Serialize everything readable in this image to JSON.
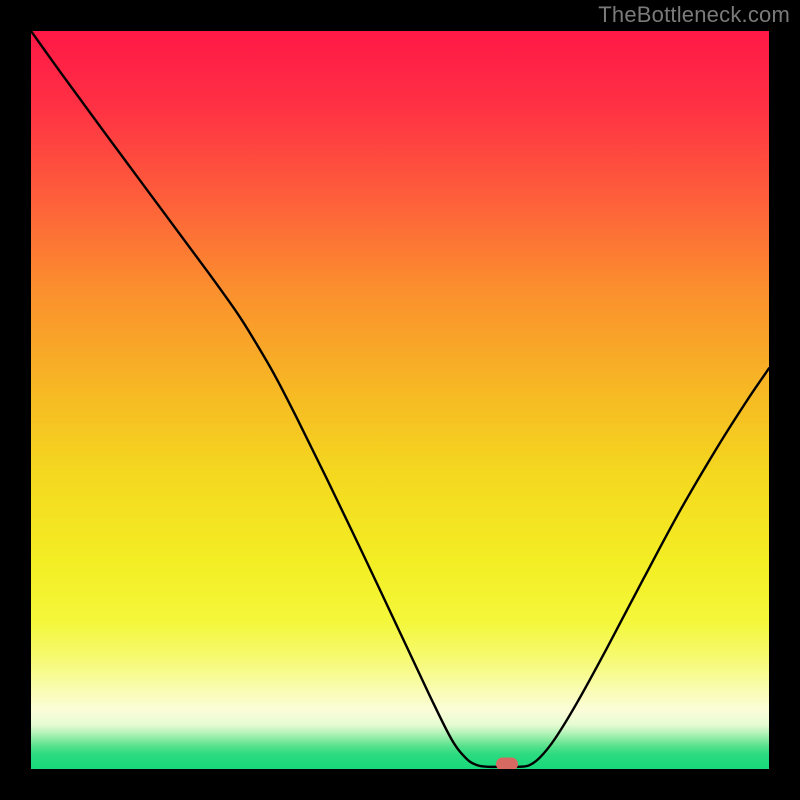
{
  "watermark": "TheBottleneck.com",
  "colors": {
    "frame_bg": "#000000",
    "curve_stroke": "#000000",
    "marker_fill": "#d66a63",
    "watermark_text": "#7a7a7a"
  },
  "gradient_stops": [
    {
      "pct": 0,
      "color": "#ff1846"
    },
    {
      "pct": 10,
      "color": "#ff3044"
    },
    {
      "pct": 22,
      "color": "#fe5c3b"
    },
    {
      "pct": 35,
      "color": "#fb8f2e"
    },
    {
      "pct": 48,
      "color": "#f7b624"
    },
    {
      "pct": 60,
      "color": "#f4d81f"
    },
    {
      "pct": 72,
      "color": "#f3ee24"
    },
    {
      "pct": 80,
      "color": "#f4f73a"
    },
    {
      "pct": 85,
      "color": "#f6fa71"
    },
    {
      "pct": 89,
      "color": "#f9fcae"
    },
    {
      "pct": 92,
      "color": "#fbfdd8"
    },
    {
      "pct": 94,
      "color": "#e6fbd2"
    },
    {
      "pct": 95,
      "color": "#baf4bc"
    },
    {
      "pct": 96,
      "color": "#86eaa0"
    },
    {
      "pct": 97,
      "color": "#52e18b"
    },
    {
      "pct": 98,
      "color": "#2cdb80"
    },
    {
      "pct": 100,
      "color": "#17d87b"
    }
  ],
  "chart_data": {
    "type": "line",
    "title": "",
    "xlabel": "",
    "ylabel": "",
    "xlim": [
      0,
      100
    ],
    "ylim": [
      0,
      100
    ],
    "curve_points": [
      {
        "x": 0.0,
        "y": 100.0
      },
      {
        "x": 4.0,
        "y": 94.4
      },
      {
        "x": 10.0,
        "y": 86.2
      },
      {
        "x": 18.0,
        "y": 75.4
      },
      {
        "x": 24.0,
        "y": 67.3
      },
      {
        "x": 28.0,
        "y": 61.7
      },
      {
        "x": 30.5,
        "y": 57.7
      },
      {
        "x": 33.0,
        "y": 53.4
      },
      {
        "x": 36.0,
        "y": 47.6
      },
      {
        "x": 40.0,
        "y": 39.5
      },
      {
        "x": 45.0,
        "y": 29.1
      },
      {
        "x": 50.0,
        "y": 18.5
      },
      {
        "x": 54.0,
        "y": 10.0
      },
      {
        "x": 57.0,
        "y": 4.0
      },
      {
        "x": 59.0,
        "y": 1.4
      },
      {
        "x": 60.5,
        "y": 0.5
      },
      {
        "x": 62.0,
        "y": 0.3
      },
      {
        "x": 64.0,
        "y": 0.3
      },
      {
        "x": 66.0,
        "y": 0.3
      },
      {
        "x": 67.5,
        "y": 0.5
      },
      {
        "x": 69.0,
        "y": 1.6
      },
      {
        "x": 71.0,
        "y": 4.1
      },
      {
        "x": 74.0,
        "y": 9.0
      },
      {
        "x": 78.0,
        "y": 16.3
      },
      {
        "x": 83.0,
        "y": 25.8
      },
      {
        "x": 88.0,
        "y": 35.1
      },
      {
        "x": 93.0,
        "y": 43.6
      },
      {
        "x": 97.0,
        "y": 49.9
      },
      {
        "x": 100.0,
        "y": 54.3
      }
    ],
    "marker": {
      "x": 64.5,
      "y": 0.7
    },
    "background": "vertical red-yellow-green gradient"
  }
}
